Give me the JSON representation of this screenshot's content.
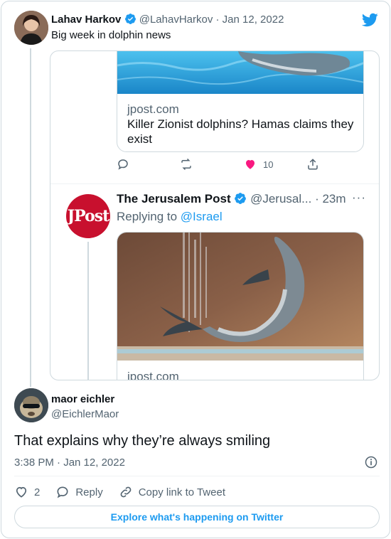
{
  "tweet": {
    "author_name": "Lahav Harkov",
    "author_handle": "@LahavHarkov",
    "date": "· Jan 12, 2022",
    "text": "Big week in dolphin news"
  },
  "quoted": {
    "link_card_1": {
      "domain": "jpost.com",
      "title": "Killer Zionist dolphins? Hamas claims they exist"
    },
    "actions": {
      "likes": "10"
    },
    "reply": {
      "author_name": "The Jerusalem Post",
      "author_handle": "@Jerusal...",
      "time": "· 23m",
      "more": "···",
      "replying_prefix": "Replying to",
      "replying_to": "@Israel",
      "logo_text": "JPost"
    },
    "link_card_2": {
      "domain": "jpost.com"
    }
  },
  "reply_tweet": {
    "author_name": "maor eichler",
    "author_handle": "@EichlerMaor",
    "text": "That explains why they’re always smiling",
    "timestamp": "3:38 PM · Jan 12, 2022"
  },
  "actions": {
    "likes": "2",
    "reply_label": "Reply",
    "copy_label": "Copy link to Tweet"
  },
  "explore_label": "Explore what's happening on Twitter",
  "colors": {
    "accent": "#1d9bf0",
    "like": "#f91880",
    "jpost_red": "#c8102e",
    "muted": "#536471",
    "border": "#cfd9de"
  }
}
